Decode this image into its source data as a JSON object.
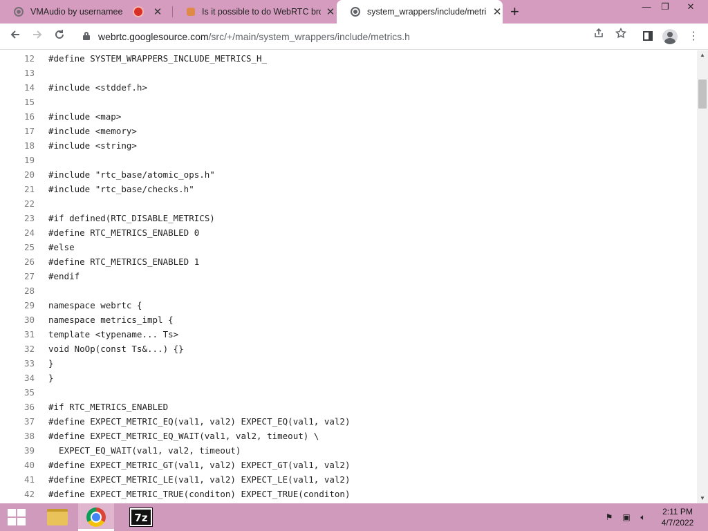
{
  "browser": {
    "tabs": [
      {
        "title": "VMAudio by usernamee",
        "recording": true,
        "active": false
      },
      {
        "title": "Is it possible to do WebRTC brow",
        "recording": false,
        "active": false
      },
      {
        "title": "system_wrappers/include/metric",
        "recording": false,
        "active": true
      }
    ],
    "new_tab_label": "+",
    "window_controls": {
      "minimize": "—",
      "restore": "❐",
      "close": "✕"
    },
    "url_domain": "webrtc.googlesource.com",
    "url_path": "/src/+/main/system_wrappers/include/metrics.h"
  },
  "code_lines": [
    {
      "n": "12",
      "text": "#define SYSTEM_WRAPPERS_INCLUDE_METRICS_H_"
    },
    {
      "n": "13",
      "text": ""
    },
    {
      "n": "14",
      "text": "#include <stddef.h>"
    },
    {
      "n": "15",
      "text": ""
    },
    {
      "n": "16",
      "text": "#include <map>"
    },
    {
      "n": "17",
      "text": "#include <memory>"
    },
    {
      "n": "18",
      "text": "#include <string>"
    },
    {
      "n": "19",
      "text": ""
    },
    {
      "n": "20",
      "text": "#include \"rtc_base/atomic_ops.h\""
    },
    {
      "n": "21",
      "text": "#include \"rtc_base/checks.h\""
    },
    {
      "n": "22",
      "text": ""
    },
    {
      "n": "23",
      "text": "#if defined(RTC_DISABLE_METRICS)"
    },
    {
      "n": "24",
      "text": "#define RTC_METRICS_ENABLED 0"
    },
    {
      "n": "25",
      "text": "#else"
    },
    {
      "n": "26",
      "text": "#define RTC_METRICS_ENABLED 1"
    },
    {
      "n": "27",
      "text": "#endif"
    },
    {
      "n": "28",
      "text": ""
    },
    {
      "n": "29",
      "text": "namespace webrtc {"
    },
    {
      "n": "30",
      "text": "namespace metrics_impl {"
    },
    {
      "n": "31",
      "text": "template <typename... Ts>"
    },
    {
      "n": "32",
      "text": "void NoOp(const Ts&...) {}"
    },
    {
      "n": "33",
      "text": "}"
    },
    {
      "n": "34",
      "text": "}"
    },
    {
      "n": "35",
      "text": ""
    },
    {
      "n": "36",
      "text": "#if RTC_METRICS_ENABLED"
    },
    {
      "n": "37",
      "text": "#define EXPECT_METRIC_EQ(val1, val2) EXPECT_EQ(val1, val2)"
    },
    {
      "n": "38",
      "text": "#define EXPECT_METRIC_EQ_WAIT(val1, val2, timeout) \\"
    },
    {
      "n": "39",
      "text": "  EXPECT_EQ_WAIT(val1, val2, timeout)"
    },
    {
      "n": "40",
      "text": "#define EXPECT_METRIC_GT(val1, val2) EXPECT_GT(val1, val2)"
    },
    {
      "n": "41",
      "text": "#define EXPECT_METRIC_LE(val1, val2) EXPECT_LE(val1, val2)"
    },
    {
      "n": "42",
      "text": "#define EXPECT_METRIC_TRUE(conditon) EXPECT_TRUE(conditon)"
    }
  ],
  "taskbar": {
    "apps": [
      "file-explorer",
      "chrome",
      "7-zip"
    ],
    "seven_zip_label": "7z",
    "time": "2:11 PM",
    "date": "4/7/2022"
  },
  "colors": {
    "tabstrip": "#d59cbf",
    "taskbar": "#cf9abb"
  }
}
